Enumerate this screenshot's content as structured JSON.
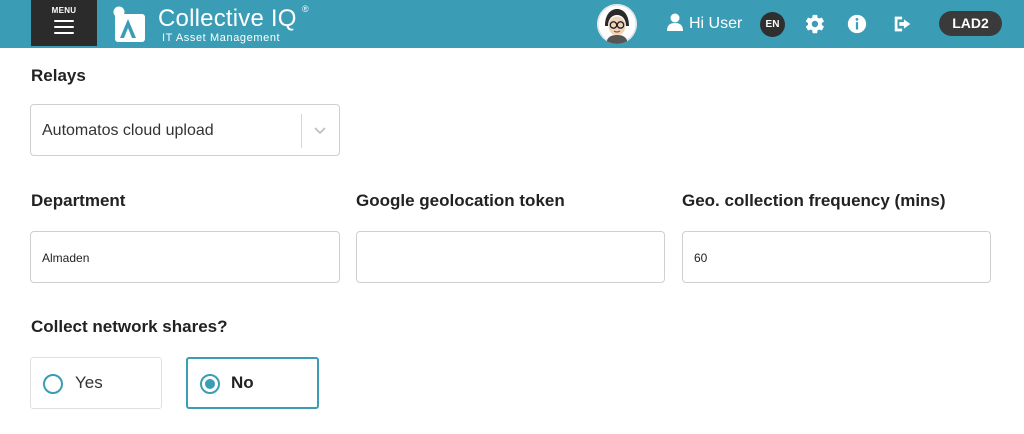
{
  "header": {
    "menu_label": "MENU",
    "brand": "Collective IQ",
    "brand_reg": "®",
    "brand_sub": "IT Asset Management",
    "greeting": "Hi User",
    "language": "EN",
    "environment": "LAD2",
    "icons": [
      "menu-icon",
      "logo-icon",
      "avatar",
      "user-icon",
      "gear-icon",
      "info-icon",
      "logout-icon"
    ]
  },
  "form": {
    "relays": {
      "label": "Relays",
      "value": "Automatos cloud upload"
    },
    "department": {
      "label": "Department",
      "value": "Almaden"
    },
    "geo_token": {
      "label": "Google geolocation token",
      "value": ""
    },
    "geo_freq": {
      "label": "Geo. collection frequency (mins)",
      "value": "60"
    },
    "network_shares": {
      "label": "Collect network shares?",
      "options": [
        {
          "label": "Yes",
          "selected": false
        },
        {
          "label": "No",
          "selected": true
        }
      ]
    }
  },
  "colors": {
    "accent": "#3a9db5",
    "dark": "#2b2b2b"
  }
}
